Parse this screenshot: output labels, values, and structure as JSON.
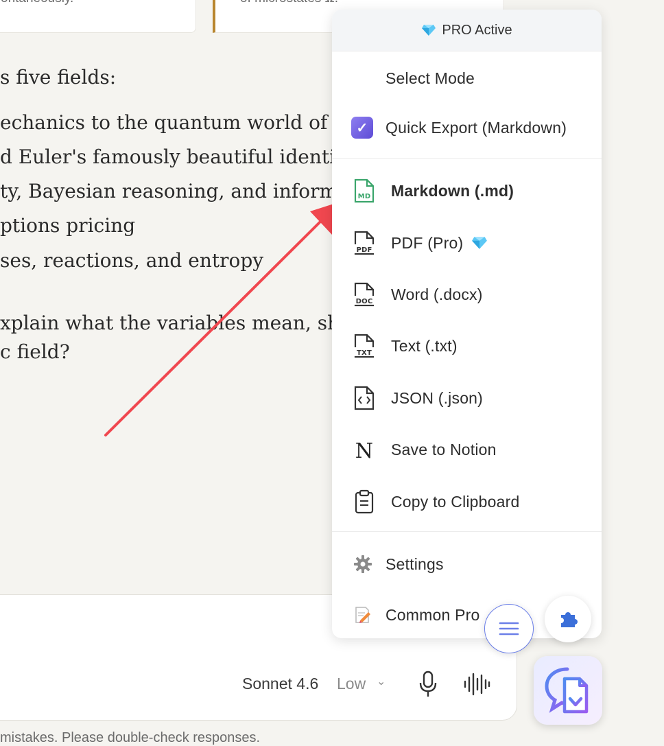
{
  "background": {
    "cards": [
      "ontaneously.",
      "of microstates Ω."
    ],
    "intro": "s five fields:",
    "bullets": [
      "echanics to the quantum world of Sc",
      "d Euler's famously beautiful identitie",
      "ty, Bayesian reasoning, and informat",
      "ptions pricing",
      "ses, reactions, and entropy"
    ],
    "question_lines": [
      "xplain what the variables mean, show",
      "c field?"
    ],
    "disclaimer": "mistakes. Please double-check responses."
  },
  "composer": {
    "model": "Sonnet 4.6",
    "effort": "Low",
    "chevron": "⌄"
  },
  "panel": {
    "header": "PRO Active",
    "select_mode": "Select Mode",
    "quick_export": "Quick Export (Markdown)",
    "quick_export_check": "✓",
    "formats": [
      {
        "label": "Markdown (.md)",
        "icon": "md-file-icon",
        "tag": "MD"
      },
      {
        "label": "PDF (Pro)",
        "icon": "pdf-file-icon",
        "tag": "PDF"
      },
      {
        "label": "Word (.docx)",
        "icon": "doc-file-icon",
        "tag": "DOC"
      },
      {
        "label": "Text (.txt)",
        "icon": "txt-file-icon",
        "tag": "TXT"
      },
      {
        "label": "JSON (.json)",
        "icon": "json-file-icon"
      },
      {
        "label": "Save to Notion",
        "icon": "notion-icon",
        "tag": "N"
      },
      {
        "label": "Copy to Clipboard",
        "icon": "clipboard-icon"
      }
    ],
    "settings": "Settings",
    "common_prompts": "Common Pro"
  },
  "colors": {
    "accent": "#6b7fe8",
    "markdown_green": "#3aa56b",
    "arrow_red": "#f0474f",
    "check_purple": "#6a58de"
  }
}
